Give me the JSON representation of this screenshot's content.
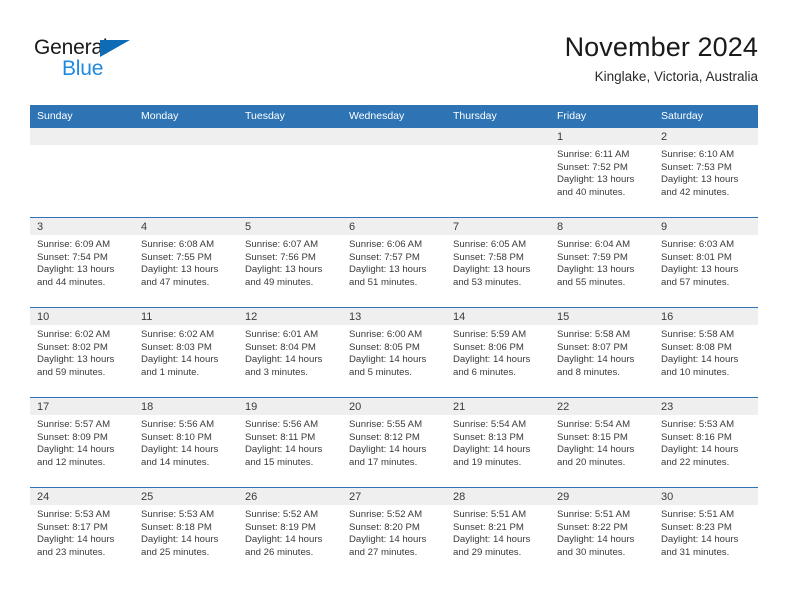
{
  "brand": {
    "name_part1": "General",
    "name_part2": "Blue",
    "triangle_color": "#0d6cb5",
    "blue_text_color": "#1f8ae0"
  },
  "header": {
    "month_title": "November 2024",
    "location": "Kinglake, Victoria, Australia"
  },
  "theme": {
    "header_blue": "#2e74b5",
    "daynum_band": "#efefef",
    "text": "#3a3a3a"
  },
  "weekdays": [
    "Sunday",
    "Monday",
    "Tuesday",
    "Wednesday",
    "Thursday",
    "Friday",
    "Saturday"
  ],
  "weeks": [
    [
      {
        "empty": true
      },
      {
        "empty": true
      },
      {
        "empty": true
      },
      {
        "empty": true
      },
      {
        "empty": true
      },
      {
        "day": "1",
        "sunrise": "Sunrise: 6:11 AM",
        "sunset": "Sunset: 7:52 PM",
        "daylight": "Daylight: 13 hours and 40 minutes."
      },
      {
        "day": "2",
        "sunrise": "Sunrise: 6:10 AM",
        "sunset": "Sunset: 7:53 PM",
        "daylight": "Daylight: 13 hours and 42 minutes."
      }
    ],
    [
      {
        "day": "3",
        "sunrise": "Sunrise: 6:09 AM",
        "sunset": "Sunset: 7:54 PM",
        "daylight": "Daylight: 13 hours and 44 minutes."
      },
      {
        "day": "4",
        "sunrise": "Sunrise: 6:08 AM",
        "sunset": "Sunset: 7:55 PM",
        "daylight": "Daylight: 13 hours and 47 minutes."
      },
      {
        "day": "5",
        "sunrise": "Sunrise: 6:07 AM",
        "sunset": "Sunset: 7:56 PM",
        "daylight": "Daylight: 13 hours and 49 minutes."
      },
      {
        "day": "6",
        "sunrise": "Sunrise: 6:06 AM",
        "sunset": "Sunset: 7:57 PM",
        "daylight": "Daylight: 13 hours and 51 minutes."
      },
      {
        "day": "7",
        "sunrise": "Sunrise: 6:05 AM",
        "sunset": "Sunset: 7:58 PM",
        "daylight": "Daylight: 13 hours and 53 minutes."
      },
      {
        "day": "8",
        "sunrise": "Sunrise: 6:04 AM",
        "sunset": "Sunset: 7:59 PM",
        "daylight": "Daylight: 13 hours and 55 minutes."
      },
      {
        "day": "9",
        "sunrise": "Sunrise: 6:03 AM",
        "sunset": "Sunset: 8:01 PM",
        "daylight": "Daylight: 13 hours and 57 minutes."
      }
    ],
    [
      {
        "day": "10",
        "sunrise": "Sunrise: 6:02 AM",
        "sunset": "Sunset: 8:02 PM",
        "daylight": "Daylight: 13 hours and 59 minutes."
      },
      {
        "day": "11",
        "sunrise": "Sunrise: 6:02 AM",
        "sunset": "Sunset: 8:03 PM",
        "daylight": "Daylight: 14 hours and 1 minute."
      },
      {
        "day": "12",
        "sunrise": "Sunrise: 6:01 AM",
        "sunset": "Sunset: 8:04 PM",
        "daylight": "Daylight: 14 hours and 3 minutes."
      },
      {
        "day": "13",
        "sunrise": "Sunrise: 6:00 AM",
        "sunset": "Sunset: 8:05 PM",
        "daylight": "Daylight: 14 hours and 5 minutes."
      },
      {
        "day": "14",
        "sunrise": "Sunrise: 5:59 AM",
        "sunset": "Sunset: 8:06 PM",
        "daylight": "Daylight: 14 hours and 6 minutes."
      },
      {
        "day": "15",
        "sunrise": "Sunrise: 5:58 AM",
        "sunset": "Sunset: 8:07 PM",
        "daylight": "Daylight: 14 hours and 8 minutes."
      },
      {
        "day": "16",
        "sunrise": "Sunrise: 5:58 AM",
        "sunset": "Sunset: 8:08 PM",
        "daylight": "Daylight: 14 hours and 10 minutes."
      }
    ],
    [
      {
        "day": "17",
        "sunrise": "Sunrise: 5:57 AM",
        "sunset": "Sunset: 8:09 PM",
        "daylight": "Daylight: 14 hours and 12 minutes."
      },
      {
        "day": "18",
        "sunrise": "Sunrise: 5:56 AM",
        "sunset": "Sunset: 8:10 PM",
        "daylight": "Daylight: 14 hours and 14 minutes."
      },
      {
        "day": "19",
        "sunrise": "Sunrise: 5:56 AM",
        "sunset": "Sunset: 8:11 PM",
        "daylight": "Daylight: 14 hours and 15 minutes."
      },
      {
        "day": "20",
        "sunrise": "Sunrise: 5:55 AM",
        "sunset": "Sunset: 8:12 PM",
        "daylight": "Daylight: 14 hours and 17 minutes."
      },
      {
        "day": "21",
        "sunrise": "Sunrise: 5:54 AM",
        "sunset": "Sunset: 8:13 PM",
        "daylight": "Daylight: 14 hours and 19 minutes."
      },
      {
        "day": "22",
        "sunrise": "Sunrise: 5:54 AM",
        "sunset": "Sunset: 8:15 PM",
        "daylight": "Daylight: 14 hours and 20 minutes."
      },
      {
        "day": "23",
        "sunrise": "Sunrise: 5:53 AM",
        "sunset": "Sunset: 8:16 PM",
        "daylight": "Daylight: 14 hours and 22 minutes."
      }
    ],
    [
      {
        "day": "24",
        "sunrise": "Sunrise: 5:53 AM",
        "sunset": "Sunset: 8:17 PM",
        "daylight": "Daylight: 14 hours and 23 minutes."
      },
      {
        "day": "25",
        "sunrise": "Sunrise: 5:53 AM",
        "sunset": "Sunset: 8:18 PM",
        "daylight": "Daylight: 14 hours and 25 minutes."
      },
      {
        "day": "26",
        "sunrise": "Sunrise: 5:52 AM",
        "sunset": "Sunset: 8:19 PM",
        "daylight": "Daylight: 14 hours and 26 minutes."
      },
      {
        "day": "27",
        "sunrise": "Sunrise: 5:52 AM",
        "sunset": "Sunset: 8:20 PM",
        "daylight": "Daylight: 14 hours and 27 minutes."
      },
      {
        "day": "28",
        "sunrise": "Sunrise: 5:51 AM",
        "sunset": "Sunset: 8:21 PM",
        "daylight": "Daylight: 14 hours and 29 minutes."
      },
      {
        "day": "29",
        "sunrise": "Sunrise: 5:51 AM",
        "sunset": "Sunset: 8:22 PM",
        "daylight": "Daylight: 14 hours and 30 minutes."
      },
      {
        "day": "30",
        "sunrise": "Sunrise: 5:51 AM",
        "sunset": "Sunset: 8:23 PM",
        "daylight": "Daylight: 14 hours and 31 minutes."
      }
    ]
  ]
}
